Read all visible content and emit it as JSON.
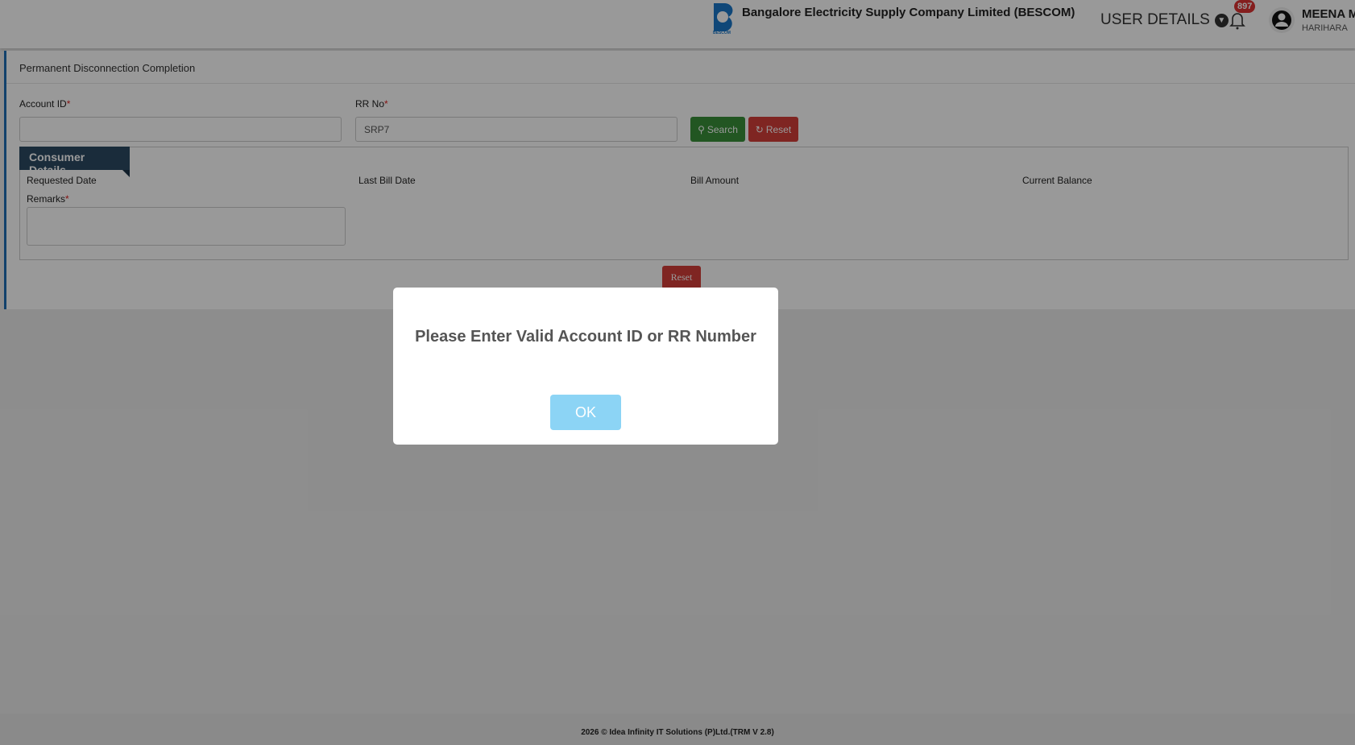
{
  "header": {
    "company": "Bangalore Electricity Supply Company Limited (BESCOM)",
    "logo_text": "BESCOM",
    "user_details": "USER DETAILS",
    "notification_count": "897",
    "user_name": "MEENA M",
    "user_location": "HARIHARA"
  },
  "page": {
    "title": "Permanent Disconnection Completion",
    "account_id_label": "Account ID",
    "rr_no_label": "RR No",
    "required_mark": "*",
    "account_id_value": "",
    "rr_no_value": "SRP7",
    "search_label": "Search",
    "reset_label": "Reset",
    "consumer_details": {
      "tab": "Consumer Details",
      "requested_date": "Requested Date",
      "last_bill_date": "Last Bill Date",
      "bill_amount": "Bill Amount",
      "current_balance": "Current Balance",
      "remarks": "Remarks"
    },
    "bottom_reset": "Reset"
  },
  "modal": {
    "message": "Please Enter Valid Account ID or RR Number",
    "ok": "OK"
  },
  "footer": {
    "text": "2026 © Idea Infinity IT Solutions (P)Ltd.(TRM V 2.8)"
  },
  "colors": {
    "search": "#3a8f3a",
    "reset": "#d43f3a",
    "ok": "#8cd4f5",
    "tab": "#2c4a63"
  }
}
